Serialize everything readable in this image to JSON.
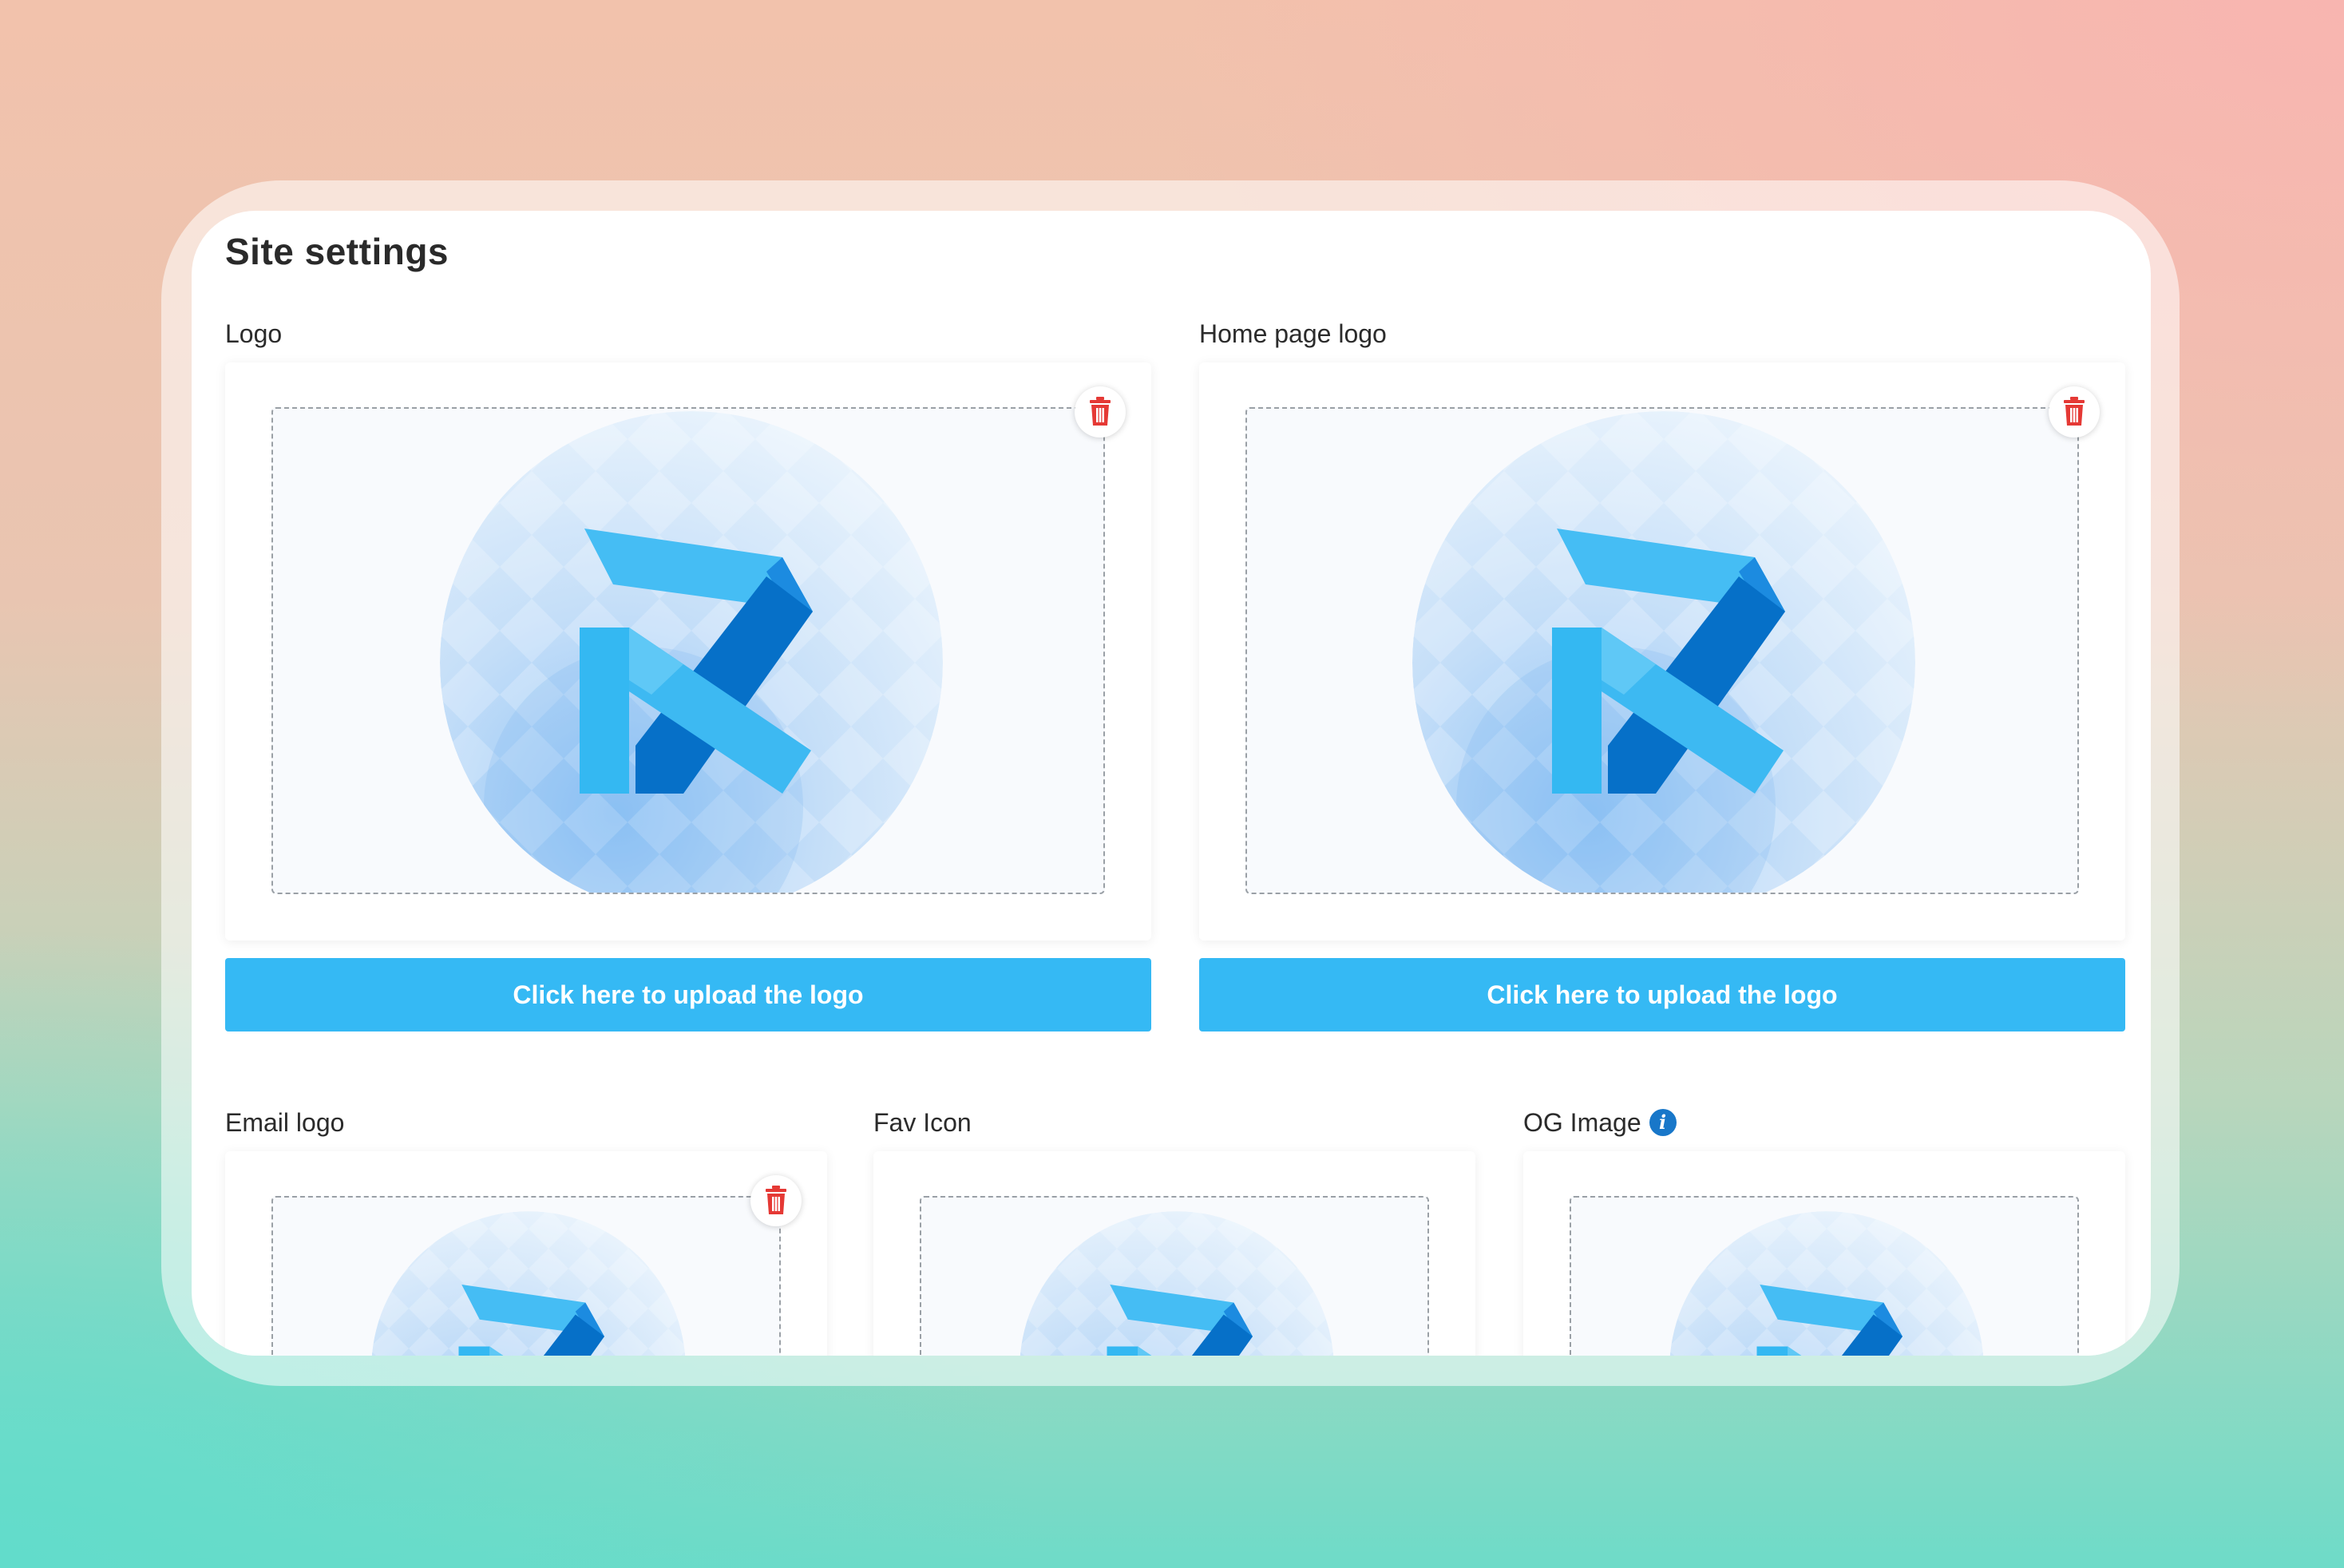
{
  "page": {
    "title": "Site settings"
  },
  "colors": {
    "accent": "#35b9f4",
    "danger": "#e53935",
    "info": "#1877c9"
  },
  "sections": {
    "logo": {
      "label": "Logo",
      "upload_label": "Click here to upload the logo",
      "delete_icon": "trash-icon"
    },
    "home_page_logo": {
      "label": "Home page logo",
      "upload_label": "Click here to upload the logo",
      "delete_icon": "trash-icon"
    },
    "email_logo": {
      "label": "Email logo",
      "delete_icon": "trash-icon"
    },
    "fav_icon": {
      "label": "Fav Icon"
    },
    "og_image": {
      "label": "OG Image",
      "info_icon": "info-icon",
      "info_glyph": "i"
    }
  }
}
